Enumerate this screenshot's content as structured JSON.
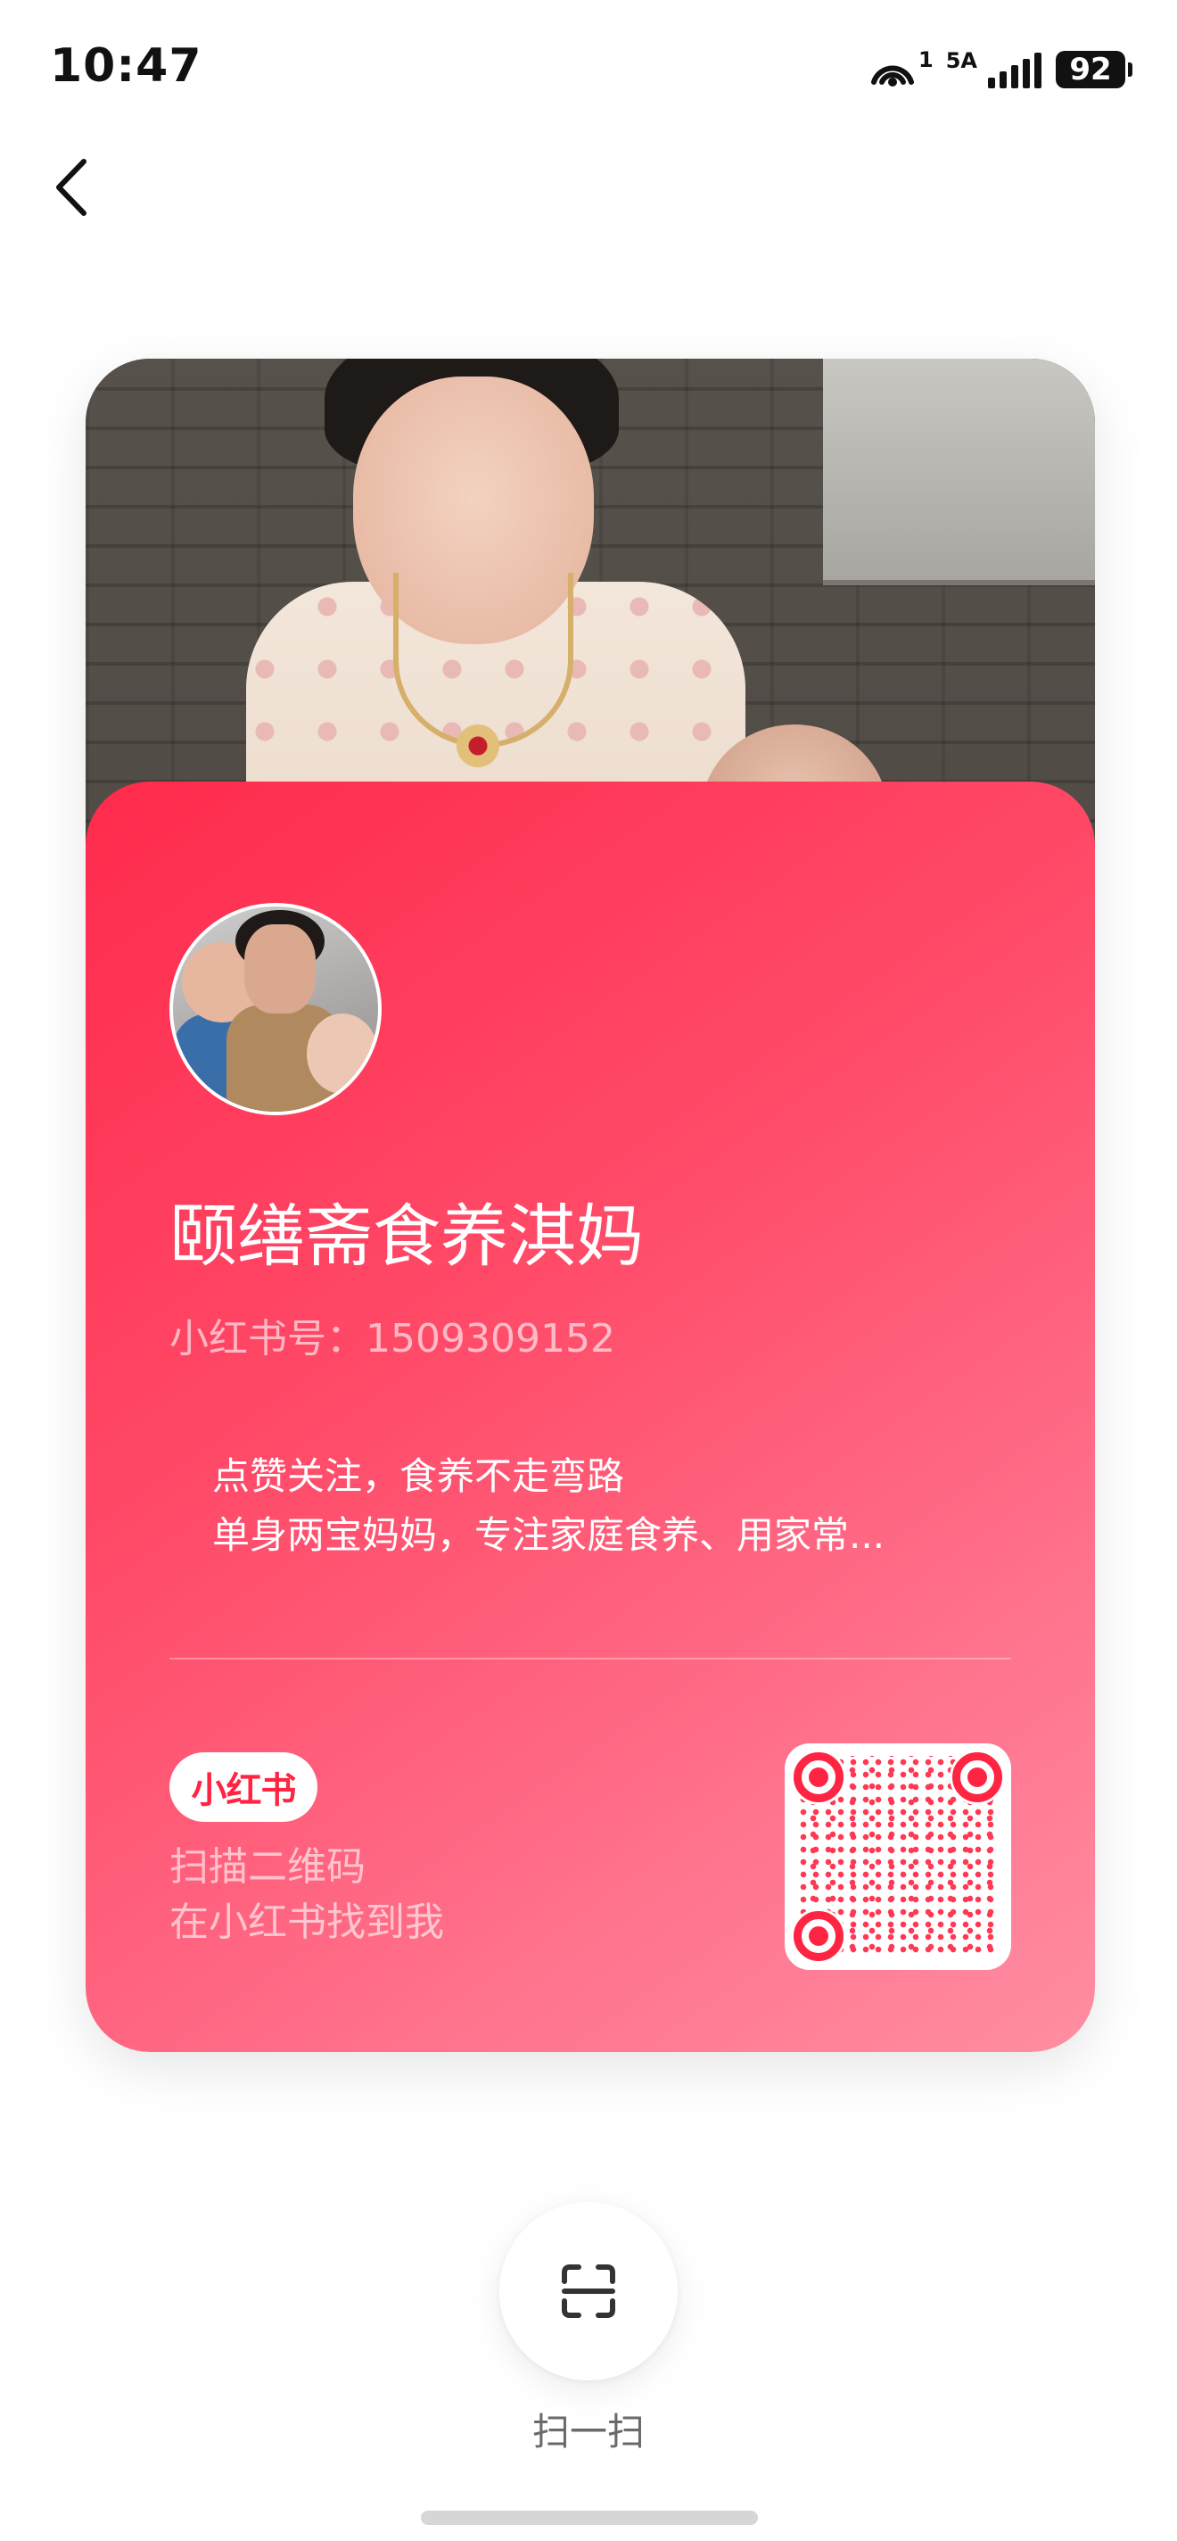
{
  "status_bar": {
    "time": "10:47",
    "hotspot_count": "1",
    "network": "5A",
    "battery": "92"
  },
  "profile": {
    "name": "颐缮斋食养淇妈",
    "red_id": "小红书号：1509309152",
    "bio_lines": [
      "点赞关注，食养不走弯路",
      "单身两宝妈妈，专注家庭食养、用家常..."
    ]
  },
  "brand": {
    "logo_text": "小红书",
    "accent": "#ff2442"
  },
  "scan_hint_lines": [
    "扫描二维码",
    "在小红书找到我"
  ],
  "scan": {
    "label": "扫一扫"
  },
  "colors": {
    "card_gradient_start": "#ff2a4c",
    "card_gradient_end": "#ff8ea2"
  }
}
